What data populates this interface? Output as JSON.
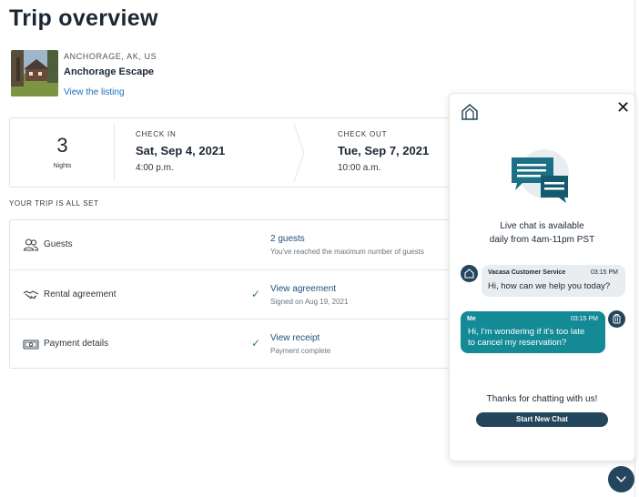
{
  "page": {
    "title": "Trip overview"
  },
  "listing": {
    "location": "ANCHORAGE, AK, US",
    "name": "Anchorage Escape",
    "link_label": "View the listing"
  },
  "stay": {
    "nights_value": "3",
    "nights_label": "Nights",
    "check_in": {
      "caption": "CHECK IN",
      "date": "Sat, Sep 4, 2021",
      "time": "4:00 p.m."
    },
    "check_out": {
      "caption": "CHECK OUT",
      "date": "Tue, Sep 7, 2021",
      "time": "10:00 a.m."
    }
  },
  "trip_status": {
    "heading": "YOUR TRIP IS ALL SET"
  },
  "details": {
    "rows": [
      {
        "label": "Guests",
        "icon": "guests-icon",
        "link": "2 guests",
        "sub": "You've reached the maximum number of guests",
        "checked": false
      },
      {
        "label": "Rental agreement",
        "icon": "handshake-icon",
        "link": "View agreement",
        "sub": "Signed on Aug 19, 2021",
        "checked": true
      },
      {
        "label": "Payment details",
        "icon": "cash-icon",
        "link": "View receipt",
        "sub": "Payment complete",
        "checked": true
      }
    ]
  },
  "chat": {
    "close_icon": "close-icon",
    "availability_line1": "Live chat is available",
    "availability_line2": "daily from 4am-11pm PST",
    "messages": [
      {
        "sender": "Vacasa Customer Service",
        "time": "03:15 PM",
        "text": "Hi, how can we help you today?"
      },
      {
        "sender": "Me",
        "time": "03:15 PM",
        "text_line1": "Hi, I'm wondering if it's too late",
        "text_line2": "to cancel my reservation?"
      }
    ],
    "thanks": "Thanks for chatting with us!",
    "start_button": "Start New Chat"
  },
  "colors": {
    "brand_dark": "#24465c",
    "chat_me_bubble": "#138a96",
    "link_blue": "#1f6fbf",
    "check_green": "#2f8a4c"
  }
}
